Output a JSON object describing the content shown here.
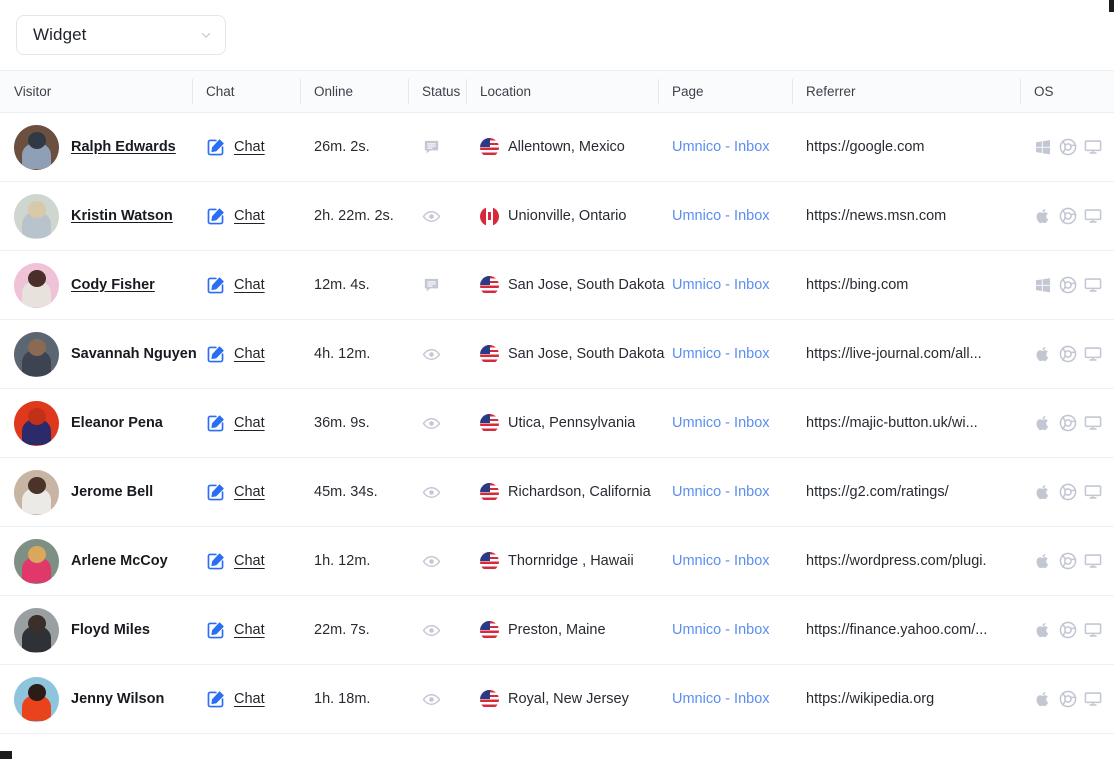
{
  "toolbar": {
    "widget_select_value": "Widget",
    "chevron_icon": "chevron-down-icon"
  },
  "table": {
    "columns": [
      {
        "key": "visitor",
        "label": "Visitor"
      },
      {
        "key": "chat",
        "label": "Chat"
      },
      {
        "key": "online",
        "label": "Online"
      },
      {
        "key": "status",
        "label": "Status"
      },
      {
        "key": "location",
        "label": "Location"
      },
      {
        "key": "page",
        "label": "Page"
      },
      {
        "key": "referrer",
        "label": "Referrer"
      },
      {
        "key": "os",
        "label": "OS"
      }
    ],
    "chat_action_label": "Chat",
    "rows": [
      {
        "name": "Ralph Edwards",
        "name_is_link": true,
        "chat": "Chat",
        "online": "26m. 2s.",
        "status_icon": "chat-bubble-icon",
        "flag": "us",
        "location": "Allentown, Mexico",
        "page": "Umnico - Inbox",
        "referrer": "https://google.com",
        "os_icon": "windows-icon",
        "browser_icon": "chrome-icon",
        "device_icon": "desktop-monitor-icon",
        "avatar": {
          "bg": "#6b4f3f",
          "mid": "#8f9fb5",
          "top": "#2f3a44"
        }
      },
      {
        "name": "Kristin Watson",
        "name_is_link": true,
        "chat": "Chat",
        "online": "2h. 22m. 2s.",
        "status_icon": "eye-icon",
        "flag": "ca",
        "location": "Unionville, Ontario",
        "page": "Umnico - Inbox",
        "referrer": "https://news.msn.com",
        "os_icon": "apple-icon",
        "browser_icon": "chrome-icon",
        "device_icon": "desktop-monitor-icon",
        "avatar": {
          "bg": "#cfd6d0",
          "mid": "#b9c3cc",
          "top": "#d8c9a8"
        }
      },
      {
        "name": "Cody Fisher",
        "name_is_link": true,
        "chat": "Chat",
        "online": "12m. 4s.",
        "status_icon": "chat-bubble-icon",
        "flag": "us",
        "location": "San Jose, South Dakota",
        "page": "Umnico - Inbox",
        "referrer": "https://bing.com",
        "os_icon": "windows-icon",
        "browser_icon": "chrome-icon",
        "device_icon": "desktop-monitor-icon",
        "avatar": {
          "bg": "#f0c2d8",
          "mid": "#e8e2dc",
          "top": "#4a2e2a"
        }
      },
      {
        "name": "Savannah Nguyen",
        "name_is_link": false,
        "chat": "Chat",
        "online": "4h. 12m.",
        "status_icon": "eye-icon",
        "flag": "us",
        "location": "San Jose, South Dakota",
        "page": "Umnico - Inbox",
        "referrer": "https://live-journal.com/all...",
        "os_icon": "apple-icon",
        "browser_icon": "chrome-icon",
        "device_icon": "desktop-monitor-icon",
        "avatar": {
          "bg": "#5c6672",
          "mid": "#3b4450",
          "top": "#8a6a52"
        }
      },
      {
        "name": "Eleanor Pena",
        "name_is_link": false,
        "chat": "Chat",
        "online": "36m. 9s.",
        "status_icon": "eye-icon",
        "flag": "us",
        "location": "Utica, Pennsylvania",
        "page": "Umnico - Inbox",
        "referrer": "https://majic-button.uk/wi...",
        "os_icon": "apple-icon",
        "browser_icon": "chrome-icon",
        "device_icon": "desktop-monitor-icon",
        "avatar": {
          "bg": "#e0381c",
          "mid": "#2b2a6b",
          "top": "#c23018"
        }
      },
      {
        "name": "Jerome Bell",
        "name_is_link": false,
        "chat": "Chat",
        "online": "45m. 34s.",
        "status_icon": "eye-icon",
        "flag": "us",
        "location": "Richardson, California",
        "page": "Umnico - Inbox",
        "referrer": "https://g2.com/ratings/",
        "os_icon": "apple-icon",
        "browser_icon": "chrome-icon",
        "device_icon": "desktop-monitor-icon",
        "avatar": {
          "bg": "#c7b4a3",
          "mid": "#eceae6",
          "top": "#4a3328"
        }
      },
      {
        "name": "Arlene McCoy",
        "name_is_link": false,
        "chat": "Chat",
        "online": "1h. 12m.",
        "status_icon": "eye-icon",
        "flag": "us",
        "location": "Thornridge , Hawaii",
        "page": "Umnico - Inbox",
        "referrer": "https://wordpress.com/plugi.",
        "os_icon": "apple-icon",
        "browser_icon": "chrome-icon",
        "device_icon": "desktop-monitor-icon",
        "avatar": {
          "bg": "#7e8f84",
          "mid": "#e0386a",
          "top": "#d9a85c"
        }
      },
      {
        "name": "Floyd Miles",
        "name_is_link": false,
        "chat": "Chat",
        "online": "22m. 7s.",
        "status_icon": "eye-icon",
        "flag": "us",
        "location": "Preston, Maine",
        "page": "Umnico - Inbox",
        "referrer": "https://finance.yahoo.com/...",
        "os_icon": "apple-icon",
        "browser_icon": "chrome-icon",
        "device_icon": "desktop-monitor-icon",
        "avatar": {
          "bg": "#9aa0a2",
          "mid": "#2e3236",
          "top": "#3a2f2a"
        }
      },
      {
        "name": "Jenny Wilson",
        "name_is_link": false,
        "chat": "Chat",
        "online": "1h. 18m.",
        "status_icon": "eye-icon",
        "flag": "us",
        "location": "Royal, New Jersey",
        "page": "Umnico - Inbox",
        "referrer": "https://wikipedia.org",
        "os_icon": "apple-icon",
        "browser_icon": "chrome-icon",
        "device_icon": "desktop-monitor-icon",
        "avatar": {
          "bg": "#8fc4dd",
          "mid": "#e8431a",
          "top": "#2b1c18"
        }
      }
    ]
  }
}
